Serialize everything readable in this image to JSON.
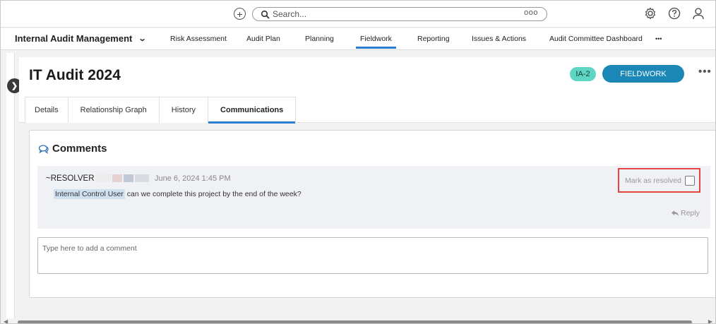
{
  "topbar": {
    "add_icon": "plus-circle-icon",
    "search": {
      "placeholder": "Search...",
      "more_icon": "ooo"
    },
    "icons": [
      "gear-icon",
      "help-icon",
      "user-icon"
    ]
  },
  "navbar": {
    "app_name": "Internal Audit Management",
    "items": [
      {
        "label": "Risk Assessment"
      },
      {
        "label": "Audit Plan"
      },
      {
        "label": "Planning"
      },
      {
        "label": "Fieldwork",
        "active": true
      },
      {
        "label": "Reporting"
      },
      {
        "label": "Issues & Actions"
      },
      {
        "label": "Audit Committee Dashboard"
      },
      {
        "label": "•••"
      }
    ]
  },
  "record": {
    "title": "IT Audit 2024",
    "id_badge": "IA-2",
    "status": "FIELDWORK",
    "more": "•••",
    "tabs": [
      {
        "label": "Details"
      },
      {
        "label": "Relationship Graph"
      },
      {
        "label": "History"
      },
      {
        "label": "Communications",
        "active": true
      }
    ]
  },
  "comments": {
    "title": "Comments",
    "items": [
      {
        "author": "~RESOLVER",
        "date": "June 6, 2024 1:45 PM",
        "mention": "Internal Control User",
        "text": " can we complete this project by the end of the week?",
        "resolve_label": "Mark as resolved",
        "reply_label": "Reply"
      }
    ],
    "input_placeholder": "Type here to add a comment"
  },
  "colors": {
    "accent": "#2d7dd2",
    "status_button": "#1a87b6",
    "id_badge": "#5fd6c3",
    "highlight_border": "#e34545"
  }
}
